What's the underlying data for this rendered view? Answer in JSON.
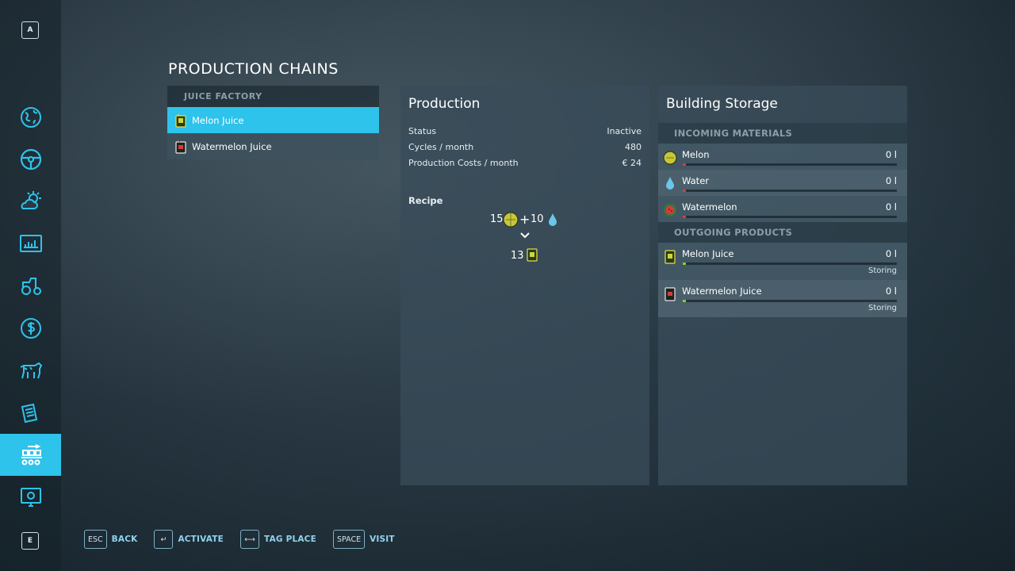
{
  "sidebar": {
    "top_key": "A",
    "bottom_key": "E",
    "items": [
      {
        "icon": "globe-icon"
      },
      {
        "icon": "steering-wheel-icon"
      },
      {
        "icon": "weather-icon"
      },
      {
        "icon": "stats-icon"
      },
      {
        "icon": "tractor-icon"
      },
      {
        "icon": "dollar-icon"
      },
      {
        "icon": "cow-icon"
      },
      {
        "icon": "contracts-icon"
      },
      {
        "icon": "production-icon",
        "active": true
      },
      {
        "icon": "help-icon"
      }
    ]
  },
  "page_title": "PRODUCTION CHAINS",
  "chains": {
    "header": "JUICE FACTORY",
    "items": [
      {
        "label": "Melon Juice",
        "selected": true
      },
      {
        "label": "Watermelon Juice",
        "selected": false
      }
    ]
  },
  "production": {
    "title": "Production",
    "rows": [
      {
        "label": "Status",
        "value": "Inactive"
      },
      {
        "label": "Cycles / month",
        "value": "480"
      },
      {
        "label": "Production Costs / month",
        "value": "€ 24"
      }
    ],
    "recipe_title": "Recipe",
    "recipe": {
      "input1_amount": "15",
      "plus": "+",
      "input2_amount": "10",
      "output_amount": "13"
    }
  },
  "storage": {
    "title": "Building Storage",
    "incoming_header": "INCOMING MATERIALS",
    "incoming": [
      {
        "name": "Melon",
        "amount": "0 l",
        "color": "#d63b3b"
      },
      {
        "name": "Water",
        "amount": "0 l",
        "color": "#d63b3b"
      },
      {
        "name": "Watermelon",
        "amount": "0 l",
        "color": "#d63b3b"
      }
    ],
    "outgoing_header": "OUTGOING PRODUCTS",
    "outgoing": [
      {
        "name": "Melon Juice",
        "amount": "0 l",
        "state": "Storing",
        "color": "#7ed321"
      },
      {
        "name": "Watermelon Juice",
        "amount": "0 l",
        "state": "Storing",
        "color": "#7ed321"
      }
    ]
  },
  "footer": [
    {
      "key": "ESC",
      "label": "BACK"
    },
    {
      "key": "↵",
      "label": "ACTIVATE"
    },
    {
      "key": "⟷",
      "label": "TAG PLACE"
    },
    {
      "key": "SPACE",
      "label": "VISIT"
    }
  ],
  "colors": {
    "accent": "#2ec3ea"
  }
}
